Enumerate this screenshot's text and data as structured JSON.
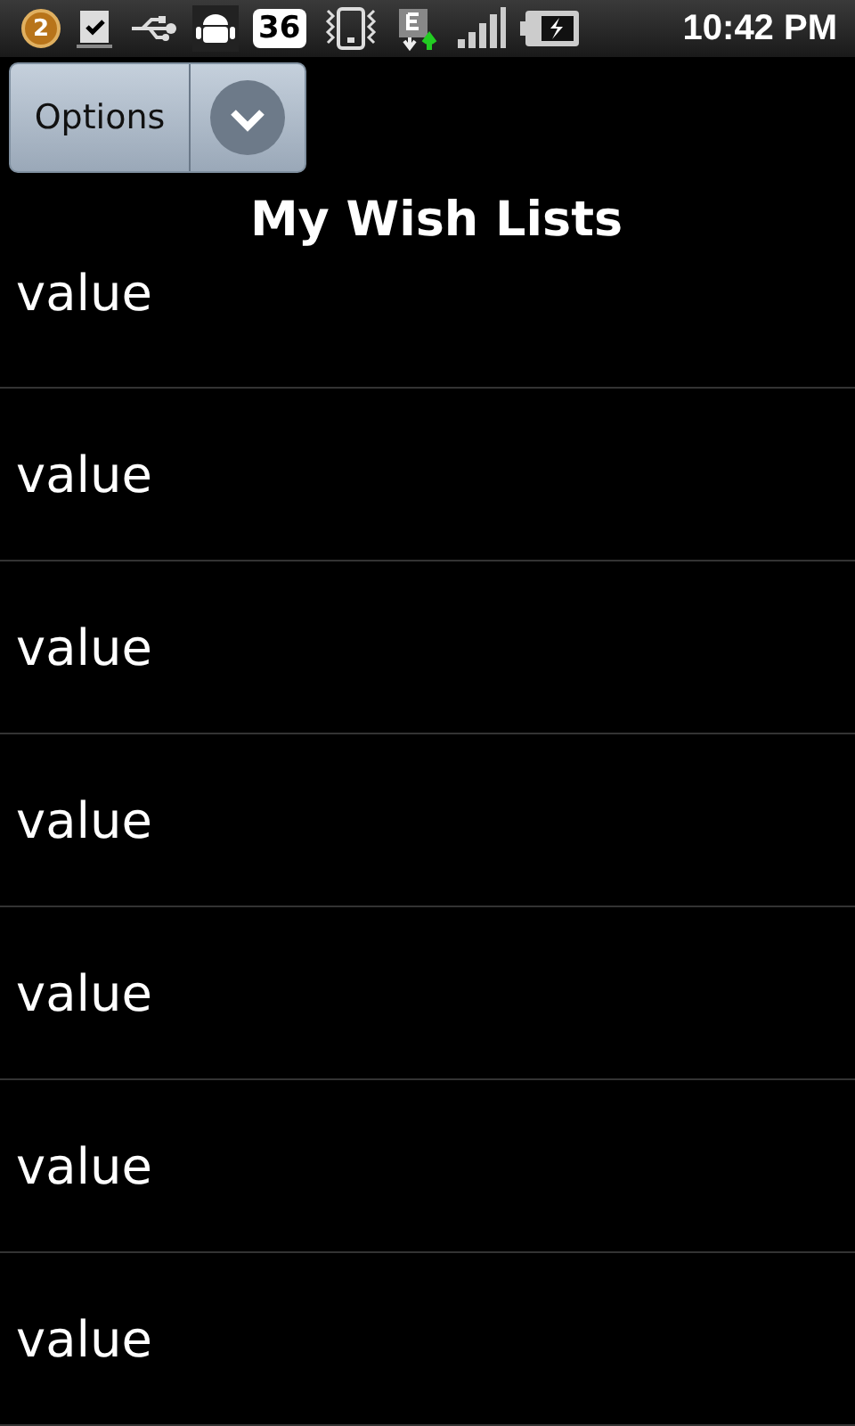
{
  "status_bar": {
    "notification_count": "2",
    "badge_number": "36",
    "time": "10:42 PM"
  },
  "options_button": {
    "label": "Options"
  },
  "title": "My Wish Lists",
  "rows": [
    {
      "text": "value"
    },
    {
      "text": "value"
    },
    {
      "text": "value"
    },
    {
      "text": "value"
    },
    {
      "text": "value"
    },
    {
      "text": "value"
    },
    {
      "text": "value"
    }
  ]
}
